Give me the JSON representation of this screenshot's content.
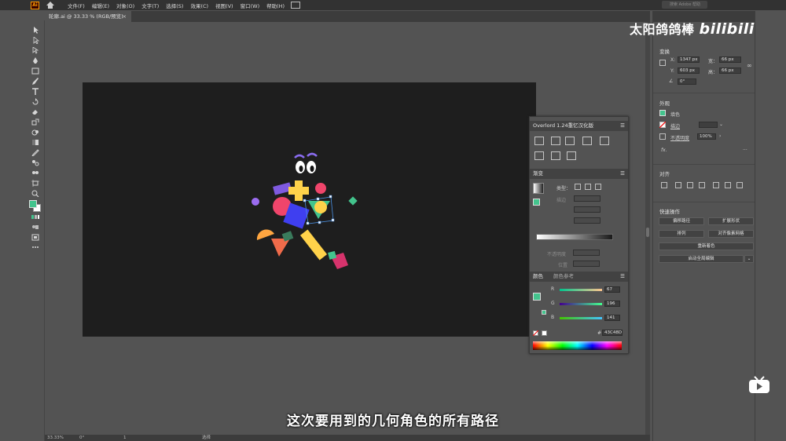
{
  "app": {
    "logo": "Ai",
    "menus": [
      "文件(F)",
      "编辑(E)",
      "对象(O)",
      "文字(T)",
      "选择(S)",
      "效果(C)",
      "视图(V)",
      "窗口(W)",
      "帮助(H)"
    ],
    "search_placeholder": "搜索 Adobe 帮助"
  },
  "document": {
    "tab_title": "轮廓.ai @ 33.33 % (RGB/预览)",
    "close": "×"
  },
  "status": {
    "zoom": "33.33%",
    "rotation": "0°",
    "page": "1",
    "tool": "选择"
  },
  "watermark": {
    "channel": "太阳鸽鸽棒",
    "site": "bilibili"
  },
  "properties": {
    "transform_title": "变换",
    "x_label": "X:",
    "x_value": "1347 px",
    "y_label": "Y:",
    "y_value": "603 px",
    "w_label": "宽：",
    "w_value": "66 px",
    "h_label": "高：",
    "h_value": "66 px",
    "angle_value": "0°",
    "appearance_title": "外观",
    "fill_label": "填色",
    "stroke_label": "描边",
    "opacity_label": "不透明度",
    "opacity_value": "100%",
    "fx_label": "fx.",
    "align_title": "对齐",
    "quick_title": "快速操作",
    "btn_offset": "偏移路径",
    "btn_expand": "扩展形状",
    "btn_arrange": "排列",
    "btn_pixel": "对齐像素网格",
    "btn_recolor": "重新着色",
    "btn_global": "启动全局编辑"
  },
  "overlord": {
    "title": "Overlord 1.24重忆汉化版",
    "gradient_tab": "渐变",
    "type_label": "类型：",
    "stroke_label": "描边",
    "opacity_label": "不透明度",
    "position_label": "位置",
    "color_tab": "颜色",
    "color_ref_tab": "颜色参考",
    "r_label": "R",
    "r_value": "67",
    "g_label": "G",
    "g_value": "196",
    "b_label": "B",
    "b_value": "141",
    "hex_label": "#",
    "hex_value": "43C48D"
  },
  "colors": {
    "fill": "#43c48d",
    "accent": "#4a90e2"
  },
  "caption": "这次要用到的几何角色的所有路径"
}
